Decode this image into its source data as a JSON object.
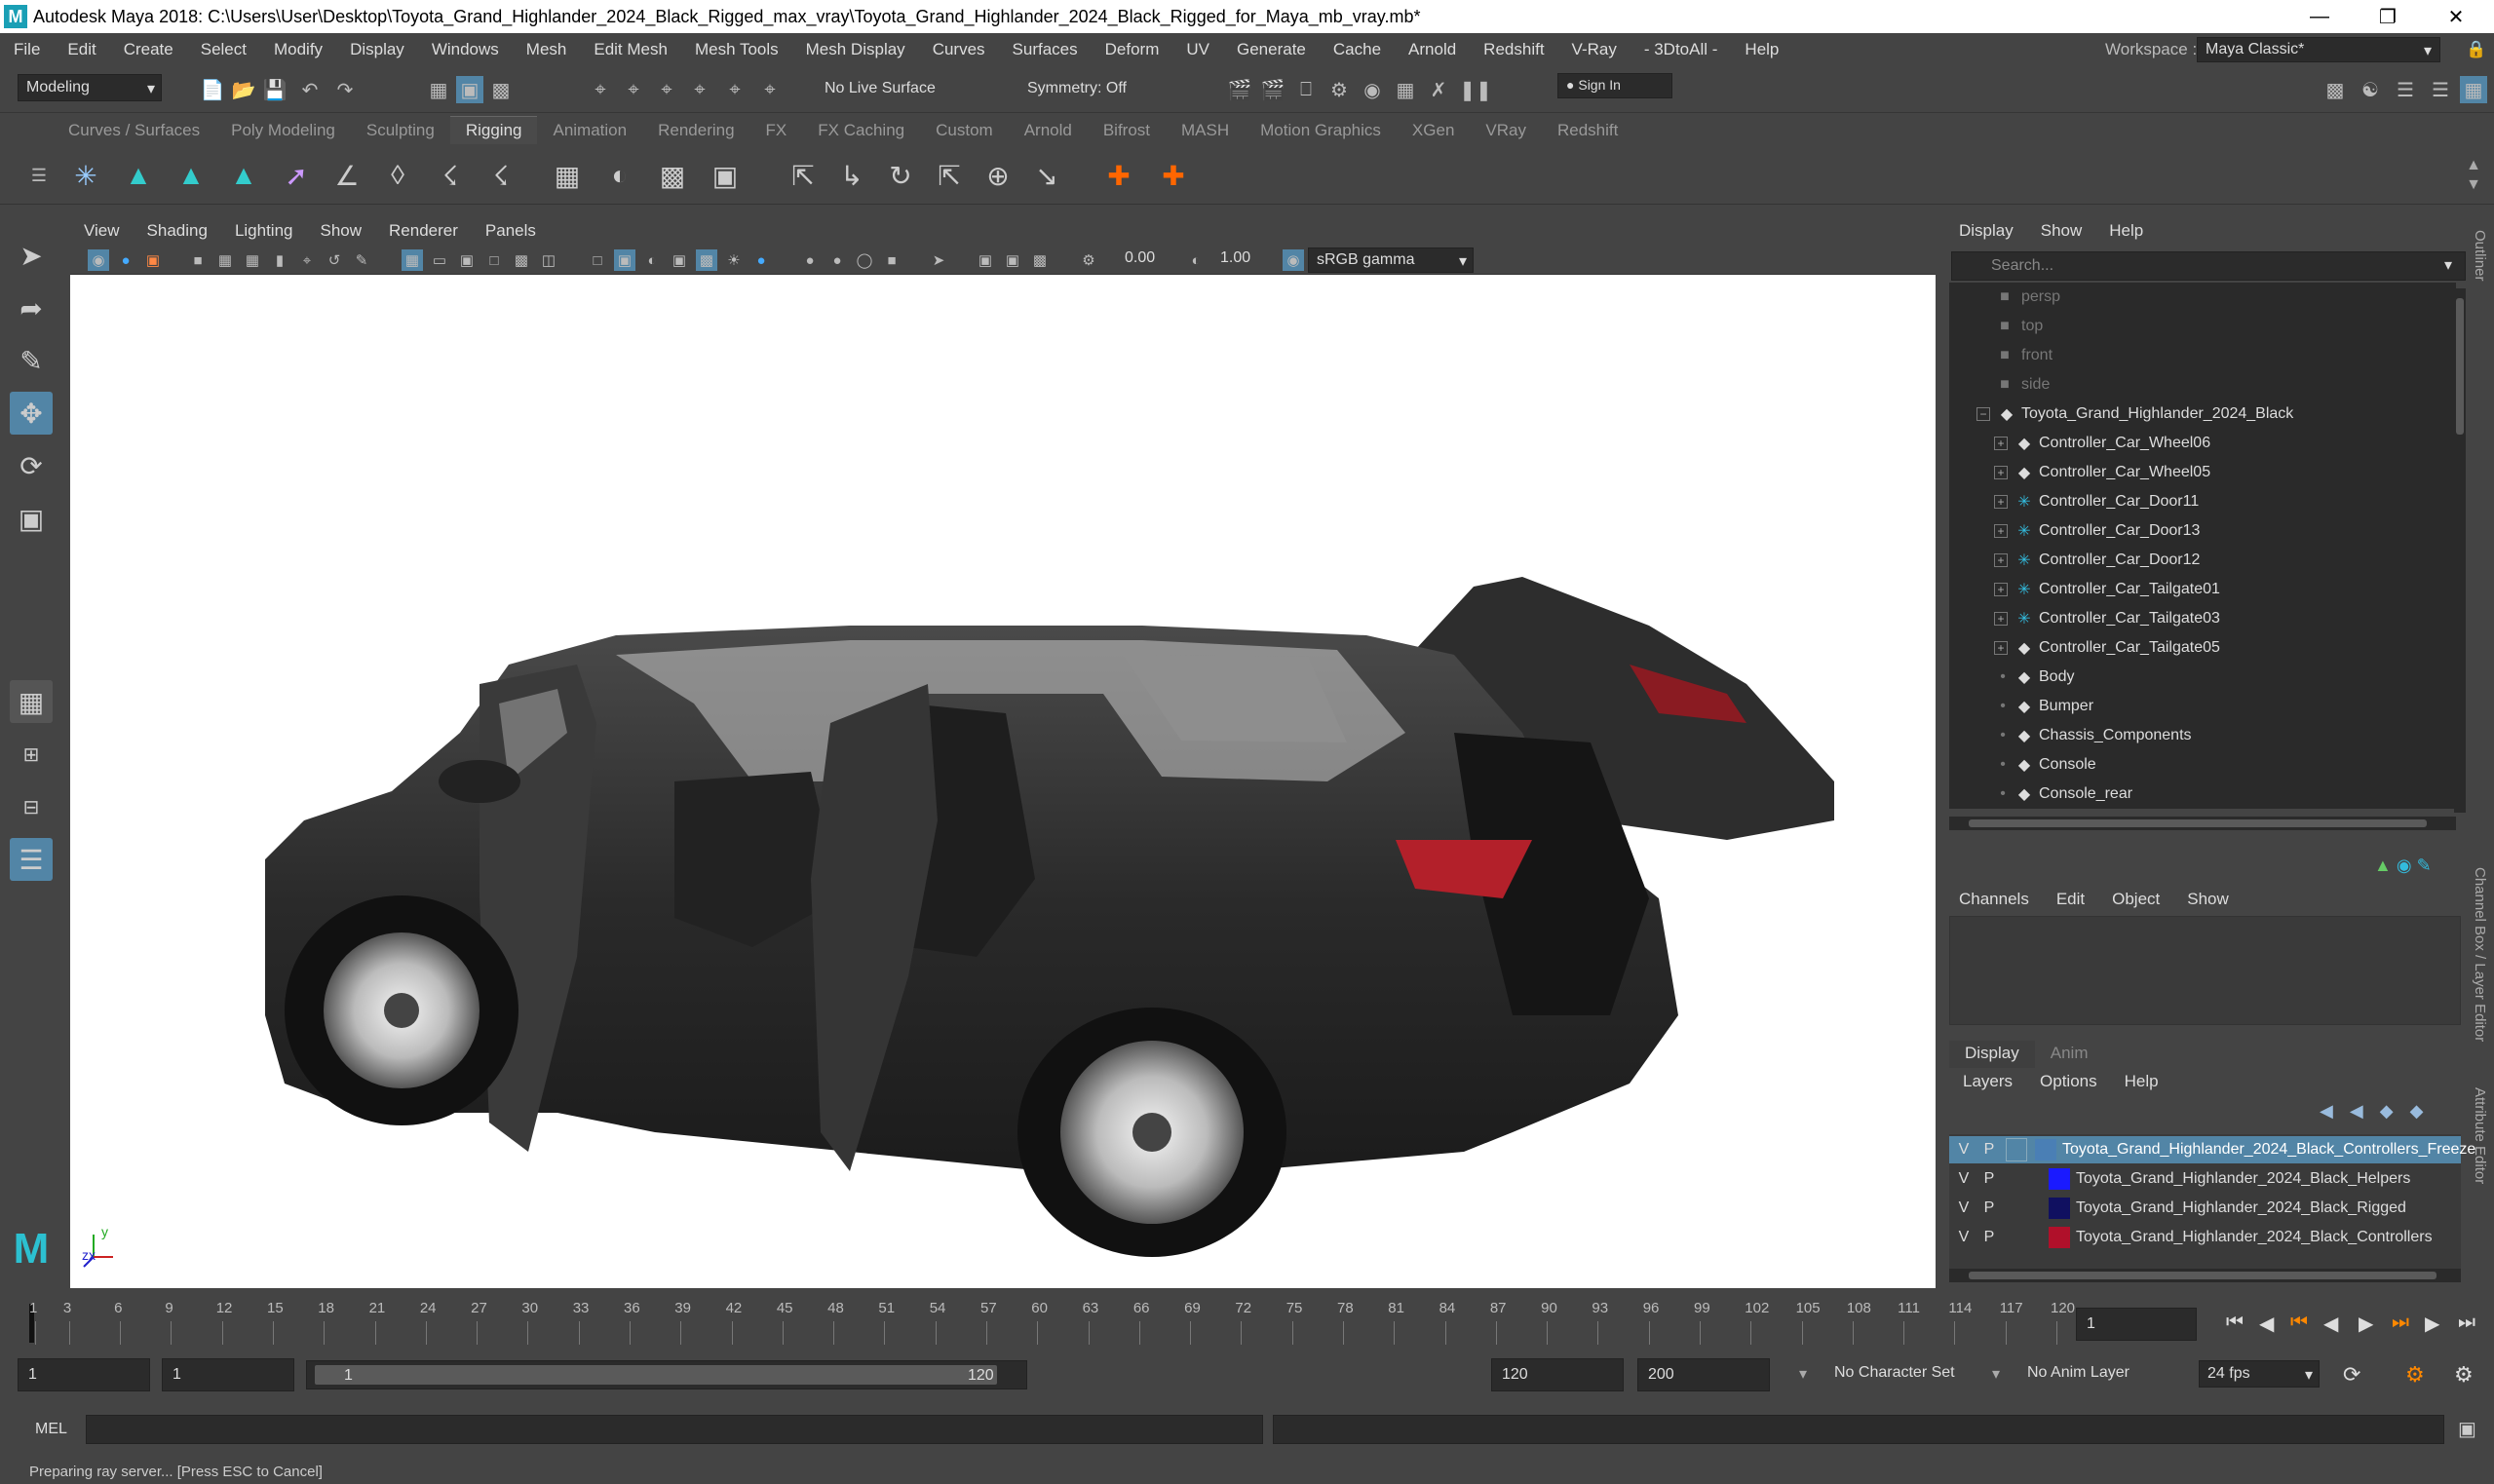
{
  "window": {
    "title": "Autodesk Maya 2018: C:\\Users\\User\\Desktop\\Toyota_Grand_Highlander_2024_Black_Rigged_max_vray\\Toyota_Grand_Highlander_2024_Black_Rigged_for_Maya_mb_vray.mb*",
    "logo": "M"
  },
  "menu": [
    "File",
    "Edit",
    "Create",
    "Select",
    "Modify",
    "Display",
    "Windows",
    "Mesh",
    "Edit Mesh",
    "Mesh Tools",
    "Mesh Display",
    "Curves",
    "Surfaces",
    "Deform",
    "UV",
    "Generate",
    "Cache",
    "Arnold",
    "Redshift",
    "V-Ray",
    "- 3DtoAll -",
    "Help"
  ],
  "workspace": {
    "label": "Workspace :",
    "value": "Maya Classic*"
  },
  "statusline": {
    "mode": "Modeling",
    "live_surface": "No Live Surface",
    "symmetry": "Symmetry: Off",
    "sign_in": "Sign In"
  },
  "shelf_tabs": [
    "Curves / Surfaces",
    "Poly Modeling",
    "Sculpting",
    "Rigging",
    "Animation",
    "Rendering",
    "FX",
    "FX Caching",
    "Custom",
    "Arnold",
    "Bifrost",
    "MASH",
    "Motion Graphics",
    "XGen",
    "VRay",
    "Redshift"
  ],
  "shelf_active": "Rigging",
  "panel_menu": [
    "View",
    "Shading",
    "Lighting",
    "Show",
    "Renderer",
    "Panels"
  ],
  "panel_fields": {
    "exposure": "0.00",
    "gamma": "1.00",
    "colorspace": "sRGB gamma"
  },
  "axis": {
    "y": "y",
    "zx": "zx"
  },
  "outliner": {
    "menu": [
      "Display",
      "Show",
      "Help"
    ],
    "search_placeholder": "Search...",
    "cameras": [
      "persp",
      "top",
      "front",
      "side"
    ],
    "root": "Toyota_Grand_Highlander_2024_Black",
    "children": [
      {
        "name": "Controller_Car_Wheel06",
        "type": "transform",
        "expandable": true
      },
      {
        "name": "Controller_Car_Wheel05",
        "type": "transform",
        "expandable": true
      },
      {
        "name": "Controller_Car_Door11",
        "type": "joint",
        "expandable": true
      },
      {
        "name": "Controller_Car_Door13",
        "type": "joint",
        "expandable": true
      },
      {
        "name": "Controller_Car_Door12",
        "type": "joint",
        "expandable": true
      },
      {
        "name": "Controller_Car_Tailgate01",
        "type": "joint",
        "expandable": true
      },
      {
        "name": "Controller_Car_Tailgate03",
        "type": "joint",
        "expandable": true
      },
      {
        "name": "Controller_Car_Tailgate05",
        "type": "transform",
        "expandable": true
      },
      {
        "name": "Body",
        "type": "transform",
        "expandable": false
      },
      {
        "name": "Bumper",
        "type": "transform",
        "expandable": false
      },
      {
        "name": "Chassis_Components",
        "type": "transform",
        "expandable": false
      },
      {
        "name": "Console",
        "type": "transform",
        "expandable": false
      },
      {
        "name": "Console_rear",
        "type": "transform",
        "expandable": false
      }
    ]
  },
  "side_tabs": {
    "outliner": "Outliner",
    "channel_box": "Channel Box / Layer Editor",
    "attribute_editor": "Attribute Editor"
  },
  "channel_box": {
    "menu": [
      "Channels",
      "Edit",
      "Object",
      "Show"
    ]
  },
  "layer_editor": {
    "tabs": [
      "Display",
      "Anim"
    ],
    "menu": [
      "Layers",
      "Options",
      "Help"
    ],
    "layers": [
      {
        "v": "V",
        "p": "P",
        "color": "#4a7fb5",
        "name": "Toyota_Grand_Highlander_2024_Black_Controllers_Freeze",
        "selected": true
      },
      {
        "v": "V",
        "p": "P",
        "color": "#1a1aff",
        "name": "Toyota_Grand_Highlander_2024_Black_Helpers",
        "selected": false
      },
      {
        "v": "V",
        "p": "P",
        "color": "#101060",
        "name": "Toyota_Grand_Highlander_2024_Black_Rigged",
        "selected": false
      },
      {
        "v": "V",
        "p": "P",
        "color": "#b0102a",
        "name": "Toyota_Grand_Highlander_2024_Black_Controllers",
        "selected": false
      }
    ]
  },
  "timeline": {
    "ticks": [
      "1",
      "3",
      "6",
      "9",
      "12",
      "15",
      "18",
      "21",
      "24",
      "27",
      "30",
      "33",
      "36",
      "39",
      "42",
      "45",
      "48",
      "51",
      "54",
      "57",
      "60",
      "63",
      "66",
      "69",
      "72",
      "75",
      "78",
      "81",
      "84",
      "87",
      "90",
      "93",
      "96",
      "99",
      "102",
      "105",
      "108",
      "111",
      "114",
      "117",
      "120"
    ],
    "current_frame": "1"
  },
  "range": {
    "start": "1",
    "anim_start": "1",
    "slider_start": "1",
    "slider_end": "120",
    "end": "120",
    "anim_end": "200",
    "character_set": "No Character Set",
    "anim_layer": "No Anim Layer",
    "fps": "24 fps"
  },
  "mel": {
    "label": "MEL"
  },
  "help_line": "Preparing ray server... [Press ESC to Cancel]"
}
